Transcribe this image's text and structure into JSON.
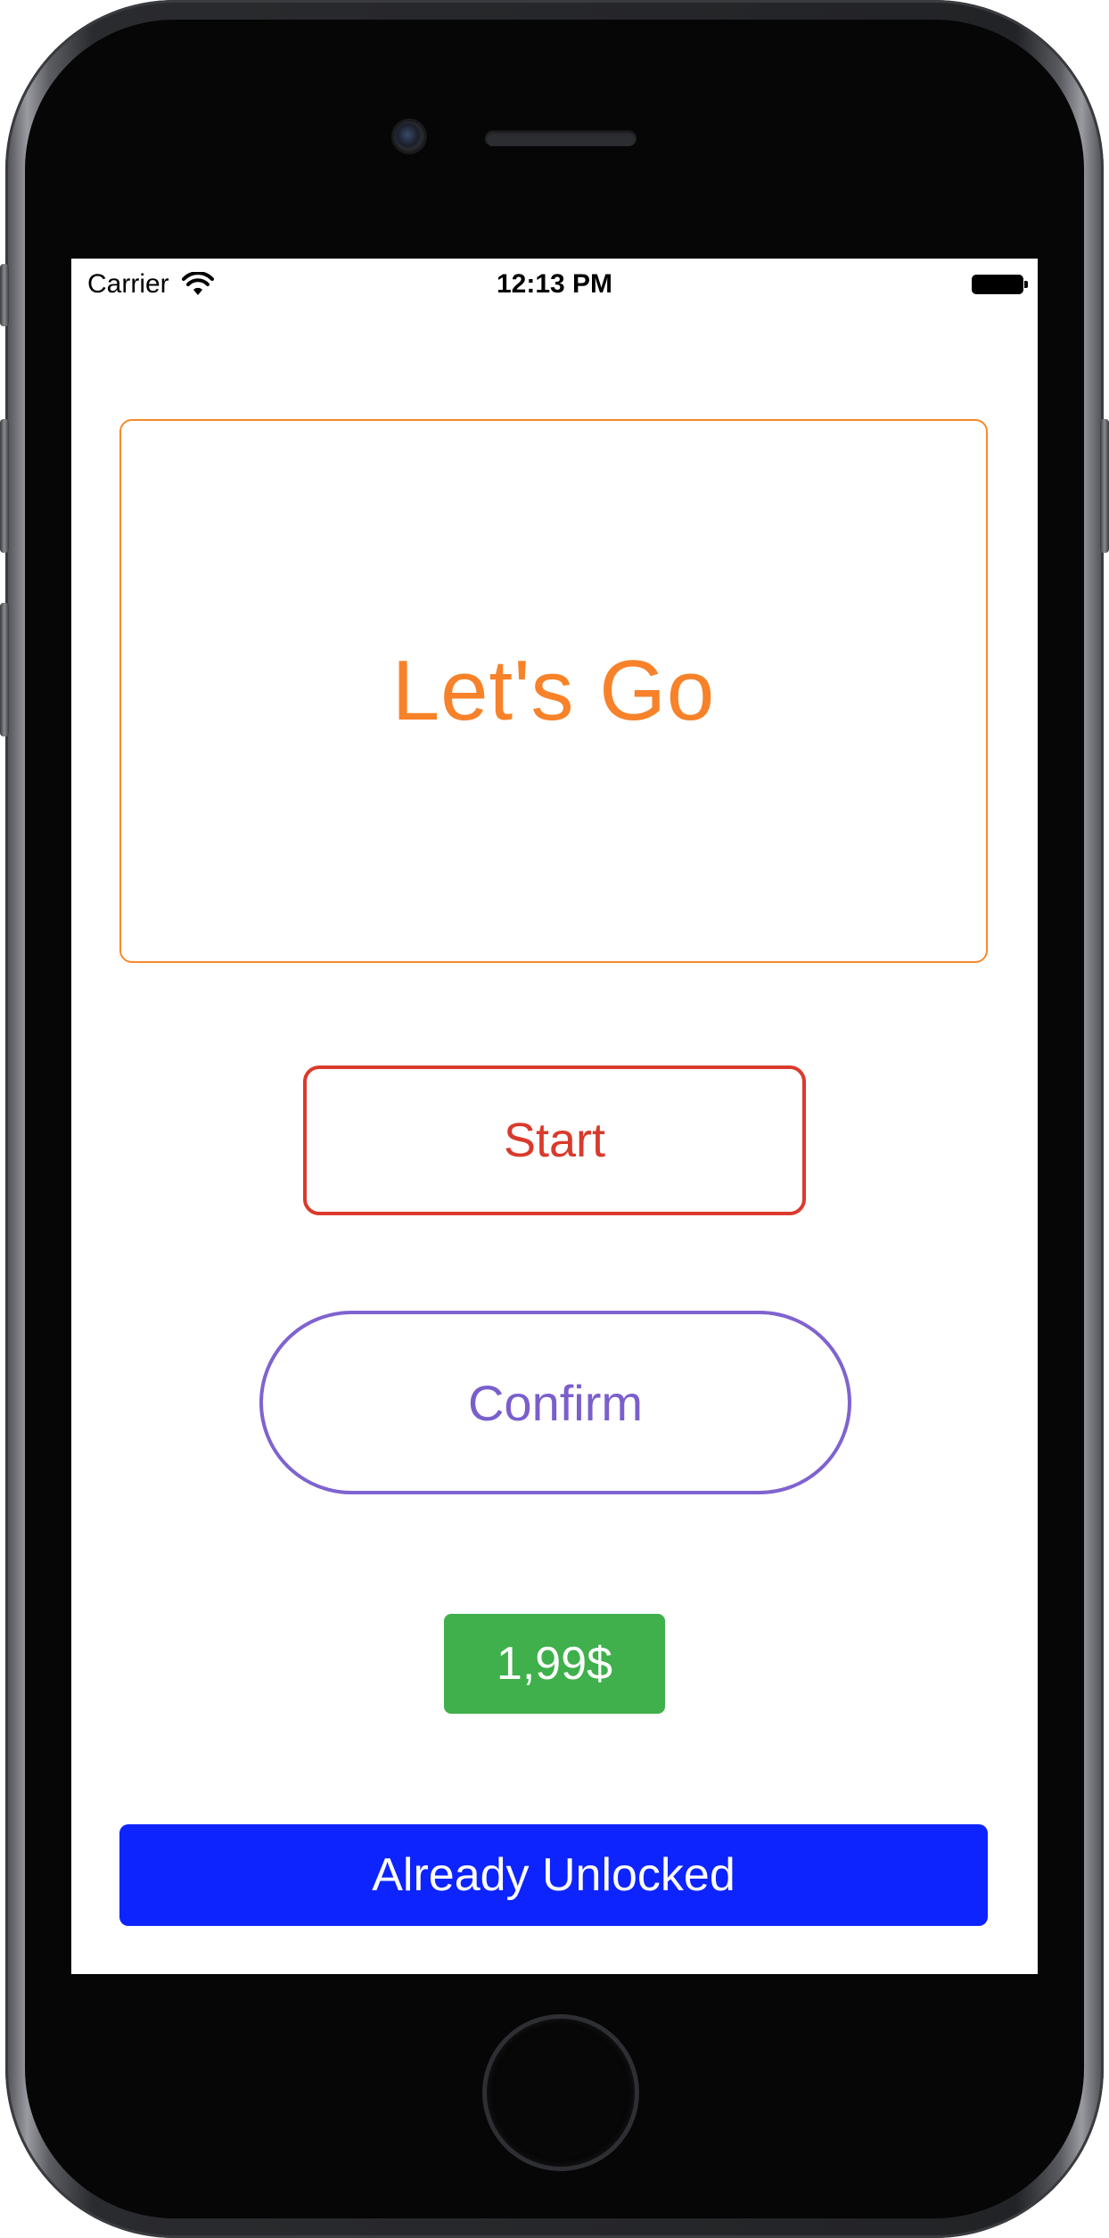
{
  "status_bar": {
    "carrier": "Carrier",
    "time": "12:13 PM",
    "wifi_icon": "wifi-icon",
    "battery_icon": "battery-icon"
  },
  "hero": {
    "text": "Let's Go",
    "color": "#f7822a"
  },
  "buttons": {
    "start_label": "Start",
    "confirm_label": "Confirm",
    "price_label": "1,99$",
    "unlocked_label": "Already Unlocked"
  },
  "colors": {
    "start": "#db3a2c",
    "confirm": "#7f63d0",
    "price_bg": "#3fb04b",
    "unlocked_bg": "#0d24ff"
  }
}
